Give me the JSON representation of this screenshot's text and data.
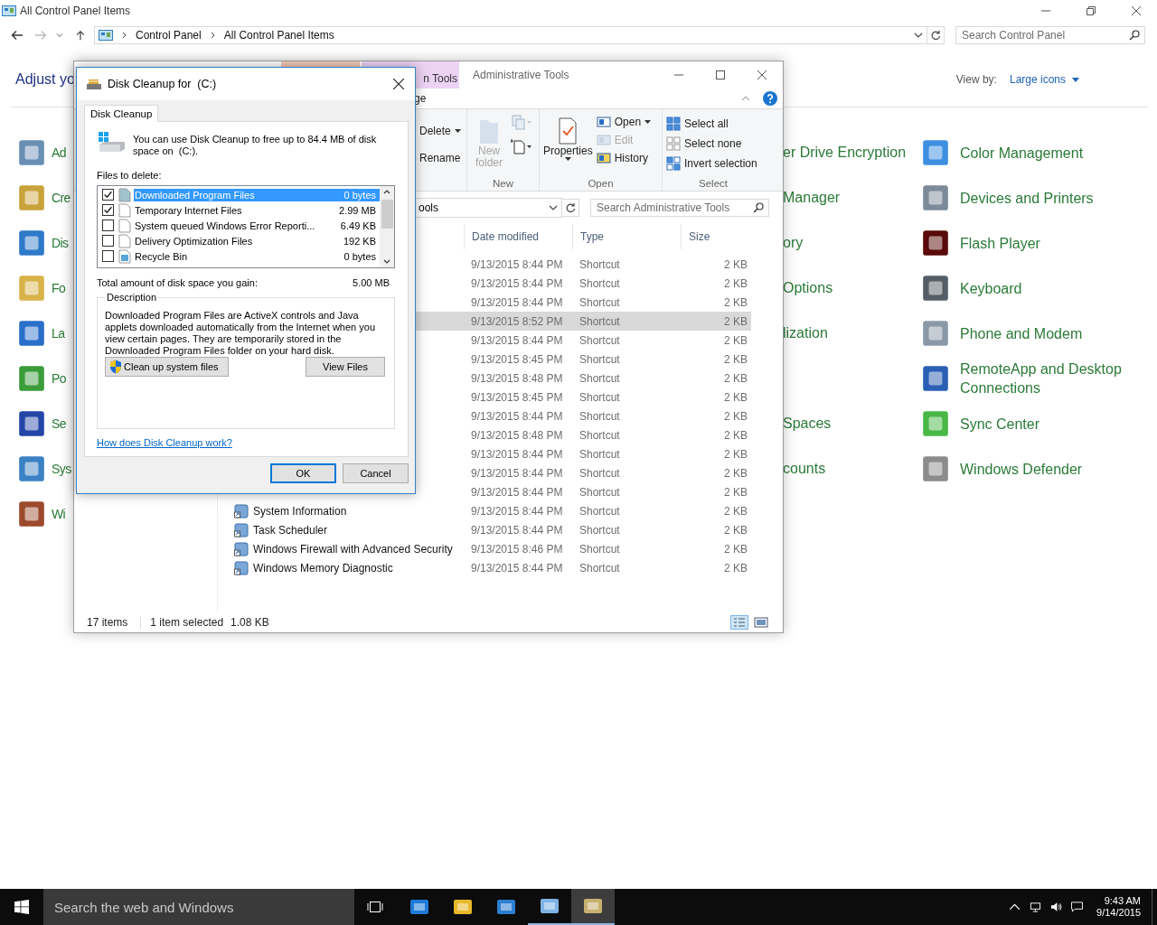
{
  "control_panel": {
    "title": "All Control Panel Items",
    "breadcrumb": [
      "Control Panel",
      "All Control Panel Items"
    ],
    "search_placeholder": "Search Control Panel",
    "heading": "Adjust yo",
    "view_by_label": "View by:",
    "view_by_value": "Large icons",
    "rows": [
      {
        "left": "Ad",
        "middle": "er Drive Encryption",
        "right": "Color Management"
      },
      {
        "left": "Cre",
        "middle": "Manager",
        "right": "Devices and Printers"
      },
      {
        "left": "Dis",
        "middle": "ory",
        "right": "Flash Player"
      },
      {
        "left": "Fo",
        "middle": "Options",
        "right": "Keyboard"
      },
      {
        "left": "La",
        "middle": "lization",
        "right": "Phone and Modem"
      },
      {
        "left": "Po",
        "right": "RemoteApp and Desktop Connections"
      },
      {
        "left": "Se",
        "middle": "Spaces",
        "right": "Sync Center"
      },
      {
        "left": "Sys",
        "middle": "counts",
        "right": "Windows Defender"
      },
      {
        "left": "Wi"
      }
    ]
  },
  "explorer": {
    "context_tab": "n Tools",
    "title": "Administrative Tools",
    "ribbon_tab": "ge",
    "organize_items": [
      {
        "label": "Delete",
        "disabled": false
      },
      {
        "label": "Rename",
        "disabled": false
      }
    ],
    "new_group": {
      "label": "New",
      "new_folder": "New folder",
      "disabled": true
    },
    "open_group": {
      "label": "Open",
      "properties": "Properties",
      "items": [
        {
          "label": "Open",
          "disabled": false
        },
        {
          "label": "Edit",
          "disabled": true
        },
        {
          "label": "History",
          "disabled": false
        }
      ]
    },
    "select_group": {
      "label": "Select",
      "items": [
        "Select all",
        "Select none",
        "Invert selection"
      ]
    },
    "address": "ools",
    "search_placeholder": "Search Administrative Tools",
    "columns": [
      "Date modified",
      "Type",
      "Size"
    ],
    "rows": [
      {
        "date": "9/13/2015 8:44 PM",
        "type": "Shortcut",
        "size": "2 KB",
        "selected": false
      },
      {
        "date": "9/13/2015 8:44 PM",
        "type": "Shortcut",
        "size": "2 KB",
        "selected": false
      },
      {
        "date": "9/13/2015 8:44 PM",
        "type": "Shortcut",
        "size": "2 KB",
        "selected": false
      },
      {
        "date": "9/13/2015 8:52 PM",
        "type": "Shortcut",
        "size": "2 KB",
        "selected": true
      },
      {
        "date": "9/13/2015 8:44 PM",
        "type": "Shortcut",
        "size": "2 KB",
        "selected": false
      },
      {
        "date": "9/13/2015 8:45 PM",
        "type": "Shortcut",
        "size": "2 KB",
        "selected": false
      },
      {
        "date": "9/13/2015 8:48 PM",
        "type": "Shortcut",
        "size": "2 KB",
        "selected": false
      },
      {
        "date": "9/13/2015 8:45 PM",
        "type": "Shortcut",
        "size": "2 KB",
        "selected": false
      },
      {
        "date": "9/13/2015 8:44 PM",
        "type": "Shortcut",
        "size": "2 KB",
        "selected": false
      },
      {
        "date": "9/13/2015 8:48 PM",
        "type": "Shortcut",
        "size": "2 KB",
        "selected": false
      },
      {
        "date": "9/13/2015 8:44 PM",
        "type": "Shortcut",
        "size": "2 KB",
        "selected": false
      },
      {
        "date": "9/13/2015 8:44 PM",
        "type": "Shortcut",
        "size": "2 KB",
        "selected": false
      },
      {
        "date": "9/13/2015 8:44 PM",
        "type": "Shortcut",
        "size": "2 KB",
        "selected": false
      },
      {
        "name": "System Information",
        "date": "9/13/2015 8:44 PM",
        "type": "Shortcut",
        "size": "2 KB",
        "selected": false
      },
      {
        "name": "Task Scheduler",
        "date": "9/13/2015 8:44 PM",
        "type": "Shortcut",
        "size": "2 KB",
        "selected": false
      },
      {
        "name": "Windows Firewall with Advanced Security",
        "date": "9/13/2015 8:46 PM",
        "type": "Shortcut",
        "size": "2 KB",
        "selected": false
      },
      {
        "name": "Windows Memory Diagnostic",
        "date": "9/13/2015 8:44 PM",
        "type": "Shortcut",
        "size": "2 KB",
        "selected": false
      }
    ],
    "status": {
      "count": "17 items",
      "selection": "1 item selected",
      "size": "1.08 KB"
    }
  },
  "dialog": {
    "title": "Disk Cleanup for  (C:)",
    "tab": "Disk Cleanup",
    "intro": "You can use Disk Cleanup to free up to 84.4 MB of disk space on  (C:).",
    "files_label": "Files to delete:",
    "files": [
      {
        "name": "Downloaded Program Files",
        "size": "0 bytes",
        "checked": true,
        "selected": true
      },
      {
        "name": "Temporary Internet Files",
        "size": "2.99 MB",
        "checked": true,
        "selected": false
      },
      {
        "name": "System queued Windows Error Reporti...",
        "size": "6.49 KB",
        "checked": false,
        "selected": false
      },
      {
        "name": "Delivery Optimization Files",
        "size": "192 KB",
        "checked": false,
        "selected": false
      },
      {
        "name": "Recycle Bin",
        "size": "0 bytes",
        "checked": false,
        "selected": false
      }
    ],
    "total_label": "Total amount of disk space you gain:",
    "total": "5.00 MB",
    "description_label": "Description",
    "description": "Downloaded Program Files are ActiveX controls and Java applets downloaded automatically from the Internet when you view certain pages. They are temporarily stored in the Downloaded Program Files folder on your hard disk.",
    "cleanup_button": "Clean up system files",
    "view_button": "View Files",
    "link": "How does Disk Cleanup work?",
    "ok": "OK",
    "cancel": "Cancel"
  },
  "taskbar": {
    "search_placeholder": "Search the web and Windows",
    "apps": [
      {
        "open": false,
        "active": false
      },
      {
        "open": false,
        "active": false
      },
      {
        "open": false,
        "active": false
      },
      {
        "open": true,
        "active": false
      },
      {
        "open": true,
        "active": true
      }
    ],
    "time": "9:43 AM",
    "date": "9/14/2015"
  }
}
